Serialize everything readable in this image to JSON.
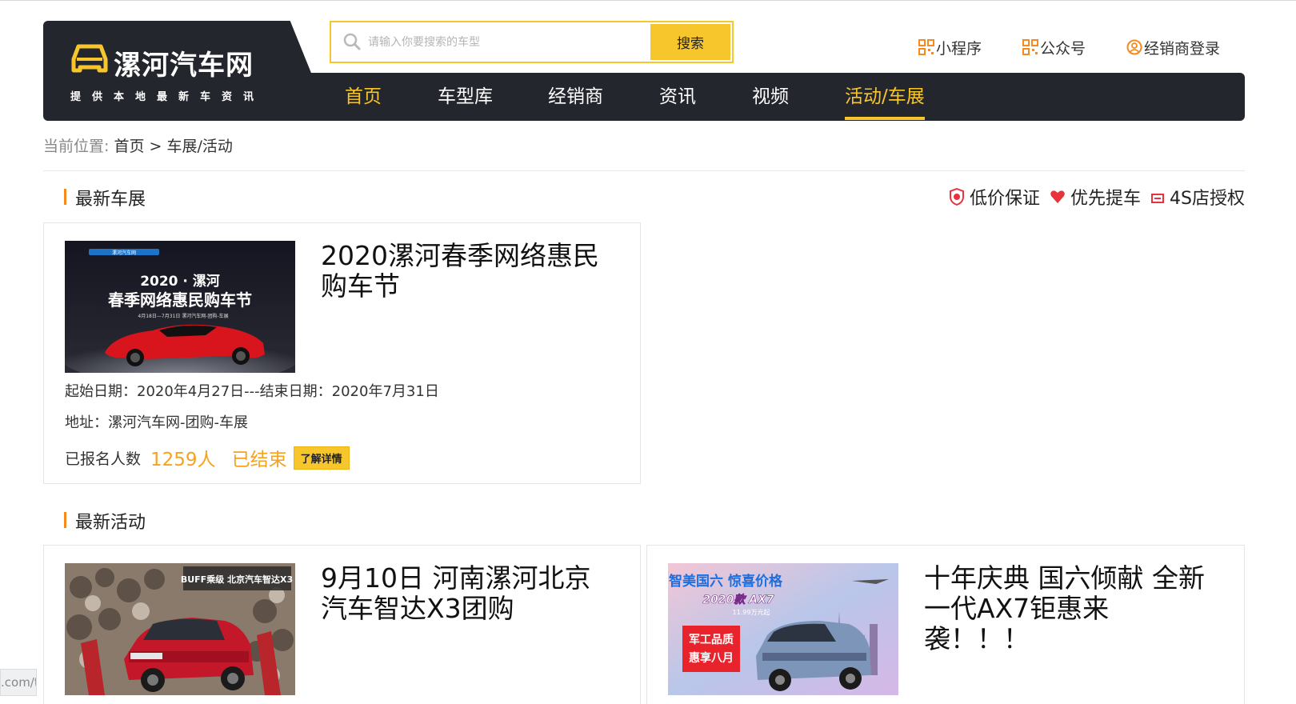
{
  "site": {
    "title": "漯河汽车网",
    "subtitle": "提供本地最新车资讯"
  },
  "search": {
    "placeholder": "请输入你要搜索的车型",
    "button_label": "搜索"
  },
  "toplinks": {
    "mini_program": "小程序",
    "official_account": "公众号",
    "dealer_login": "经销商登录"
  },
  "nav": {
    "items": [
      {
        "label": "首页"
      },
      {
        "label": "车型库"
      },
      {
        "label": "经销商"
      },
      {
        "label": "资讯"
      },
      {
        "label": "视频"
      },
      {
        "label": "活动/车展"
      }
    ]
  },
  "breadcrumb": {
    "prefix": "当前位置:",
    "home": "首页",
    "separator": ">",
    "current": "车展/活动"
  },
  "auto_show": {
    "section_title": "最新车展",
    "features": [
      "低价保证",
      "优先提车",
      "4S店授权"
    ],
    "card": {
      "title": "2020漯河春季网络惠民购车节",
      "image": {
        "line1": "2020 · 漯河",
        "line2": "春季网络惠民购车节",
        "line3": "4月18日—7月31日  漯河汽车网-团购-车展",
        "logo": "漯河汽车网"
      },
      "date_line": "起始日期：2020年4月27日---结束日期：2020年7月31日",
      "address_line": "地址：漯河汽车网-团购-车展",
      "count_label": "已报名人数",
      "count": "1259人",
      "status": "已结束",
      "detail_button": "了解详情"
    }
  },
  "activities": {
    "section_title": "最新活动",
    "items": [
      {
        "title": "9月10日 河南漯河北京汽车智达X3团购",
        "image_text": "BUFF乘级  北京汽车智达X3"
      },
      {
        "title": "十年庆典 国六倾献 全新一代AX7钜惠来袭！！！",
        "image_text_1": "智美国六 惊喜价格",
        "image_text_2": "2020款 AX7",
        "image_text_3": "11.99万元起",
        "image_text_4": "军工品质",
        "image_text_5": "惠享八月"
      }
    ]
  },
  "status_bar": {
    "url_fragment": ".com/t"
  },
  "colors": {
    "accent": "#f7c52c",
    "dark_nav": "#24262e",
    "orange": "#f7a21c",
    "section_bar": "#f58a1f",
    "feature_red": "#e8323c"
  }
}
